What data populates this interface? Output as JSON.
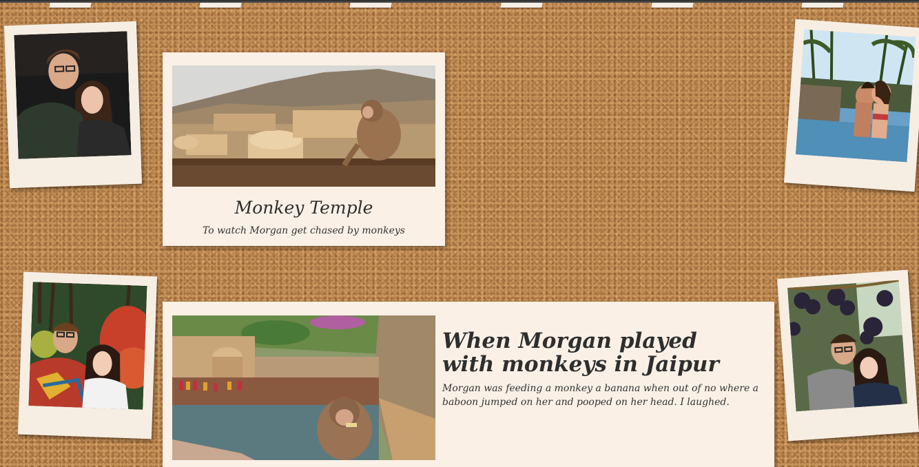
{
  "cards": [
    {
      "title": "Monkey Temple",
      "caption": "To watch Morgan get chased by monkeys"
    },
    {
      "title": "When Morgan played with monkeys in Jaipur",
      "description": "Morgan was feeding a monkey a banana when out of no where a baboon jumped on her and pooped on her head. I laughed."
    }
  ],
  "colors": {
    "cork": "#c8935a",
    "paper": "#f7eee3",
    "text": "#2e2e2e"
  }
}
